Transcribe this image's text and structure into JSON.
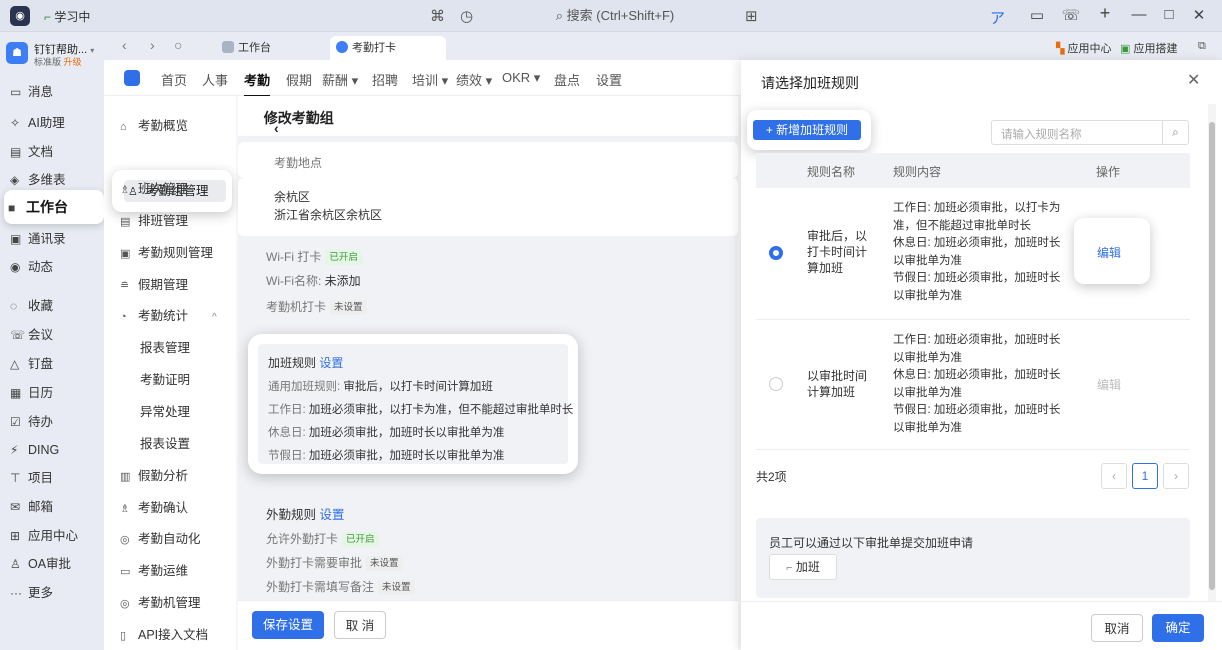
{
  "titlebar": {
    "app_logo": "dingtalk-logo",
    "study": "学习中",
    "search_placeholder": "搜索 (Ctrl+Shift+F)",
    "window_buttons": [
      "—",
      "□",
      "✕"
    ]
  },
  "org": {
    "name": "钉钉帮助...",
    "edition": "标准版",
    "upgrade": "升级"
  },
  "rail": {
    "items": [
      {
        "icon": "message-icon",
        "glyph": "▭",
        "label": "消息"
      },
      {
        "icon": "ai-icon",
        "glyph": "✧",
        "label": "AI助理"
      },
      {
        "icon": "doc-icon",
        "glyph": "▤",
        "label": "文档"
      },
      {
        "icon": "table-icon",
        "glyph": "◈",
        "label": "多维表"
      },
      {
        "icon": "workbench-icon",
        "glyph": "■",
        "label": "工作台"
      },
      {
        "icon": "contacts-icon",
        "glyph": "▣",
        "label": "通讯录"
      },
      {
        "icon": "dynamic-icon",
        "glyph": "◉",
        "label": "动态"
      },
      {
        "icon": "favorite-icon",
        "glyph": "◌",
        "label": "收藏"
      },
      {
        "icon": "meeting-icon",
        "glyph": "☏",
        "label": "会议"
      },
      {
        "icon": "disk-icon",
        "glyph": "△",
        "label": "钉盘"
      },
      {
        "icon": "calendar-icon",
        "glyph": "▦",
        "label": "日历"
      },
      {
        "icon": "todo-icon",
        "glyph": "☑",
        "label": "待办"
      },
      {
        "icon": "ding-icon",
        "glyph": "⚡",
        "label": "DING"
      },
      {
        "icon": "project-icon",
        "glyph": "⊤",
        "label": "项目"
      },
      {
        "icon": "mail-icon",
        "glyph": "✉",
        "label": "邮箱"
      },
      {
        "icon": "apps-icon",
        "glyph": "⊞",
        "label": "应用中心"
      },
      {
        "icon": "oa-icon",
        "glyph": "♙",
        "label": "OA审批"
      },
      {
        "icon": "more-icon",
        "glyph": "···",
        "label": "更多"
      }
    ]
  },
  "tabs": [
    {
      "label": "工作台"
    },
    {
      "label": "考勤打卡"
    }
  ],
  "tabbar_right": {
    "app_center": "应用中心",
    "app_builder": "应用搭建"
  },
  "topnav": [
    "首页",
    "人事",
    "考勤",
    "假期",
    "薪酬 ▾",
    "招聘",
    "培训 ▾",
    "绩效 ▾",
    "OKR ▾",
    "盘点",
    "设置"
  ],
  "subside": [
    {
      "label": "考勤概览",
      "glyph": "⌂"
    },
    {
      "label": "考勤组管理",
      "glyph": "♙"
    },
    {
      "label": "班次管理",
      "glyph": "♗"
    },
    {
      "label": "排班管理",
      "glyph": "▤"
    },
    {
      "label": "考勤规则管理",
      "glyph": "▣"
    },
    {
      "label": "假期管理",
      "glyph": "≘"
    },
    {
      "label": "考勤统计",
      "glyph": "◔",
      "chevron": "^"
    },
    {
      "label": "报表管理"
    },
    {
      "label": "考勤证明"
    },
    {
      "label": "异常处理"
    },
    {
      "label": "报表设置"
    },
    {
      "label": "假勤分析",
      "glyph": "▥"
    },
    {
      "label": "考勤确认",
      "glyph": "♗"
    },
    {
      "label": "考勤自动化",
      "glyph": "◎"
    },
    {
      "label": "考勤运维",
      "glyph": "▭"
    },
    {
      "label": "考勤机管理",
      "glyph": "◎"
    },
    {
      "label": "API接入文档",
      "glyph": "▯"
    }
  ],
  "content": {
    "title": "修改考勤组",
    "location_label": "考勤地点",
    "location_name": "余杭区",
    "location_addr": "浙江省余杭区余杭区",
    "wifi_label": "Wi-Fi 打卡",
    "wifi_tag": "已开启",
    "wifi_name_label": "Wi-Fi名称:",
    "wifi_name_value": "未添加",
    "machine_label": "考勤机打卡",
    "machine_tag": "未设置",
    "overtime": {
      "title": "加班规则",
      "setting": "设置",
      "general_label": "通用加班规则:",
      "general_value": "审批后，以打卡时间计算加班",
      "workday_label": "工作日:",
      "workday_value": "加班必须审批，以打卡为准，但不能超过审批单时长",
      "restday_label": "休息日:",
      "restday_value": "加班必须审批，加班时长以审批单为准",
      "holiday_label": "节假日:",
      "holiday_value": "加班必须审批，加班时长以审批单为准"
    },
    "field": {
      "title": "外勤规则",
      "setting": "设置",
      "allow_label": "允许外勤打卡",
      "allow_tag": "已开启",
      "approve_label": "外勤打卡需要审批",
      "approve_tag": "未设置",
      "remark_label": "外勤打卡需填写备注",
      "remark_tag": "未设置"
    },
    "save": "保存设置",
    "cancel": "取 消"
  },
  "drawer": {
    "title": "请选择加班规则",
    "add_button": "+ 新增加班规则",
    "search_placeholder": "请输入规则名称",
    "headers": {
      "name": "规则名称",
      "content": "规则内容",
      "action": "操作"
    },
    "rows": [
      {
        "selected": true,
        "name": "审批后，以打卡时间计算加班",
        "content": "工作日: 加班必须审批，以打卡为准，但不能超过审批单时长\n休息日: 加班必须审批，加班时长以审批单为准\n节假日: 加班必须审批，加班时长以审批单为准",
        "action": "编辑"
      },
      {
        "selected": false,
        "name": "以审批时间计算加班",
        "content": "工作日: 加班必须审批，加班时长以审批单为准\n休息日: 加班必须审批，加班时长以审批单为准\n节假日: 加班必须审批，加班时长以审批单为准",
        "action": "编辑"
      }
    ],
    "total": "共2项",
    "page": "1",
    "approval_note": "员工可以通过以下审批单提交加班申请",
    "approval_button": "加班",
    "cancel": "取消",
    "confirm": "确定"
  },
  "colors": {
    "accent": "#2f6fe8",
    "tag_green": "#3a9a3a",
    "upgrade": "#e86b0c"
  }
}
